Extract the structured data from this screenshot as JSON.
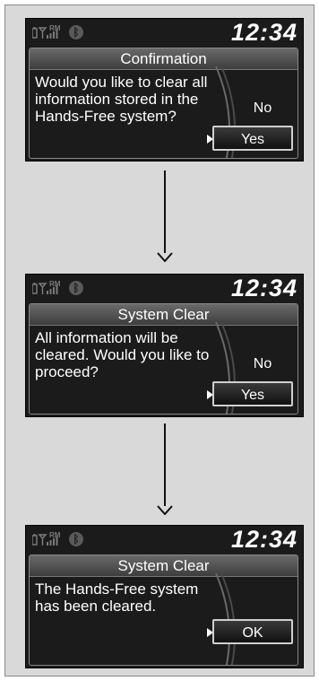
{
  "screens": [
    {
      "clock": "12:34",
      "title": "Confirmation",
      "message": "Would you like to clear all information stored in the Hands-Free system?",
      "no": "No",
      "yes": "Yes"
    },
    {
      "clock": "12:34",
      "title": "System Clear",
      "message": "All information will be cleared. Would you like to proceed?",
      "no": "No",
      "yes": "Yes"
    },
    {
      "clock": "12:34",
      "title": "System Clear",
      "message": "The Hands-Free system has been cleared.",
      "ok": "OK"
    }
  ],
  "status_icons": [
    "battery-icon",
    "signal-icon",
    "roaming-indicator",
    "bluetooth-icon"
  ],
  "roaming_label": "RM",
  "colors": {
    "screen_bg": "#1b1b1b",
    "title_bar": "#5a5a5a",
    "text": "#ffffff",
    "frame_bg": "#d9d9d9"
  }
}
